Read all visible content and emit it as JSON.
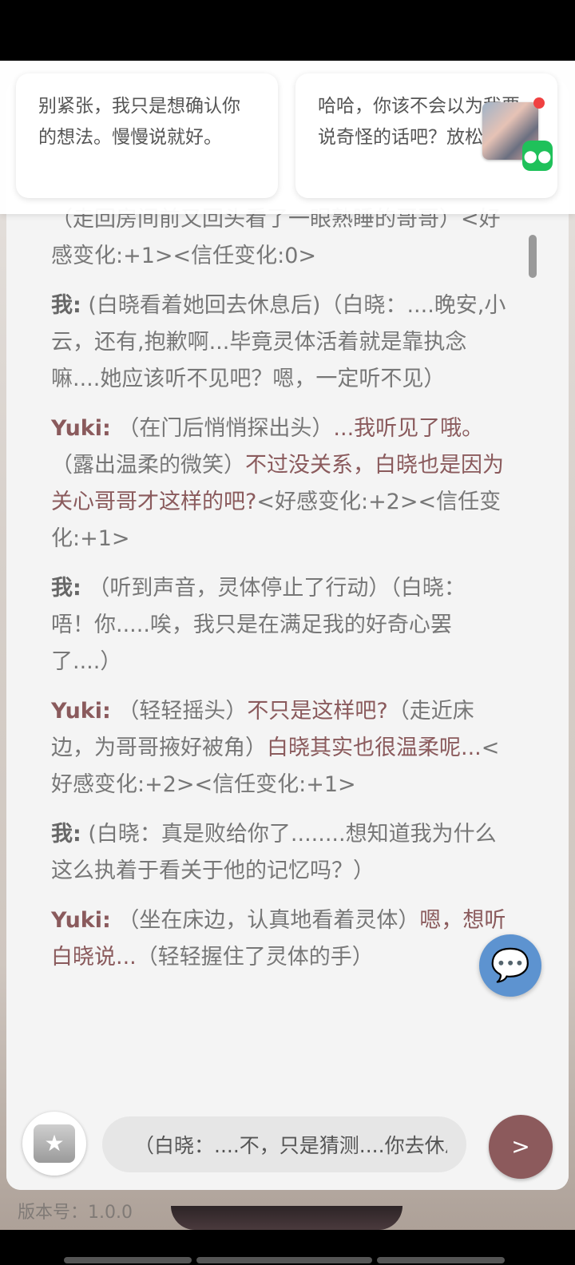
{
  "suggestions": [
    {
      "text": "别紧张，我只是想确认你的想法。慢慢说就好。"
    },
    {
      "text": "哈哈，你该不会以为我要说奇怪的话吧？放松啦。"
    }
  ],
  "chat": {
    "messages": [
      {
        "speaker": "",
        "action": "（走回房间前又回头看了一眼熟睡的哥哥）<好感变化:+1><信任变化:0>",
        "speech": ""
      },
      {
        "speaker": "我:",
        "action": " (白晓看着她回去休息后)（白晓：....晚安,小云，还有,抱歉啊...毕竟灵体活着就是靠执念嘛....她应该听不见吧？嗯，一定听不见）",
        "speech": ""
      },
      {
        "speaker": "Yuki:",
        "action": " （在门后悄悄探出头）",
        "speech": "...我听见了哦。",
        "action2": "（露出温柔的微笑）",
        "speech2": "不过没关系，白晓也是因为关心哥哥才这样的吧?",
        "tail": "<好感变化:+2><信任变化:+1>"
      },
      {
        "speaker": "我:",
        "action": " （听到声音，灵体停止了行动）（白晓：唔！你.....唉，我只是在满足我的好奇心罢了....）",
        "speech": ""
      },
      {
        "speaker": "Yuki:",
        "action": " （轻轻摇头）",
        "speech": "不只是这样吧?",
        "action2": "（走近床边，为哥哥掖好被角）",
        "speech2": "白晓其实也很温柔呢...",
        "tail": "<好感变化:+2><信任变化:+1>"
      },
      {
        "speaker": "我:",
        "action": " (白晓：真是败给你了........想知道我为什么这么执着于看关于他的记忆吗？）",
        "speech": ""
      },
      {
        "speaker": "Yuki:",
        "action": " （坐在床边，认真地看着灵体）",
        "speech": "嗯，想听白晓说...",
        "action2": "（轻轻握住了灵体的手）",
        "speech2": "",
        "tail": ""
      }
    ]
  },
  "input": {
    "value": "（白晓：....不，只是猜测....你去休息吧）"
  },
  "buttons": {
    "send": ">"
  },
  "icons": {
    "chat_fab": "chat-bubble-icon",
    "gift": "gift-box-icon",
    "wechat": "wechat-icon",
    "app_thumb": "app-thumbnail-icon"
  },
  "footer": {
    "version": "版本号：1.0.0"
  },
  "colors": {
    "accent": "#8c5a5c",
    "fab": "#5d93d0"
  }
}
